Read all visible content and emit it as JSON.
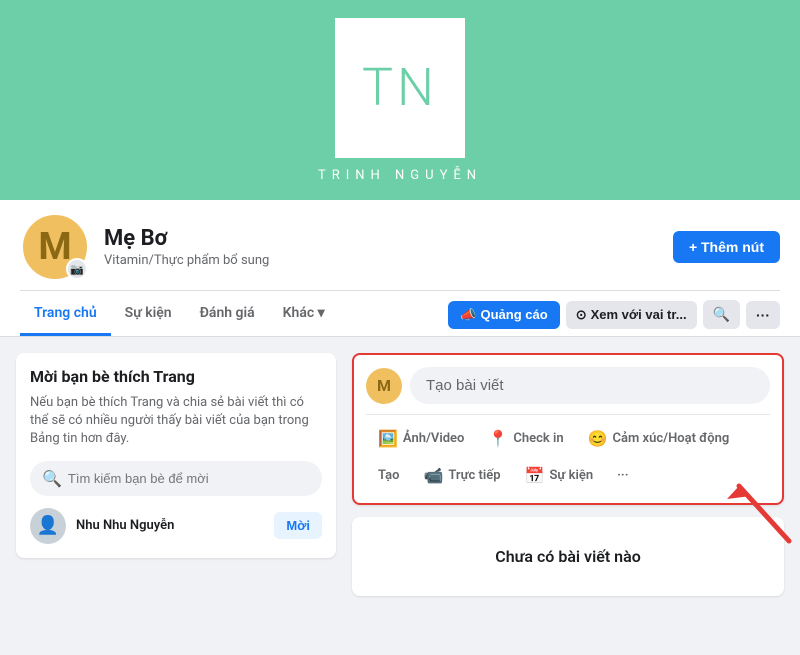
{
  "cover": {
    "logo_letters": "TN",
    "logo_name": "TRINH NGUYỄN",
    "background_color": "#6dcfa8"
  },
  "profile": {
    "avatar_letter": "M",
    "page_name": "Mẹ Bơ",
    "page_category": "Vitamin/Thực phẩm bổ sung",
    "add_button_label": "+ Thêm nút",
    "camera_icon": "📷"
  },
  "nav": {
    "tabs": [
      {
        "label": "Trang chủ",
        "active": true
      },
      {
        "label": "Sự kiện",
        "active": false
      },
      {
        "label": "Đánh giá",
        "active": false
      },
      {
        "label": "Khác ▾",
        "active": false
      }
    ],
    "actions": [
      {
        "label": "📣 Quảng cáo",
        "type": "primary"
      },
      {
        "label": "⊙ Xem với vai tr...",
        "type": "secondary"
      },
      {
        "label": "🔍",
        "type": "icon"
      },
      {
        "label": "···",
        "type": "icon"
      }
    ]
  },
  "left_sidebar": {
    "invite_title": "Mời bạn bè thích Trang",
    "invite_desc": "Nếu bạn bè thích Trang và chia sẻ bài viết thì có thể sẽ có nhiều người thấy bài viết của bạn trong Bảng tin hơn đây.",
    "search_placeholder": "Tìm kiếm bạn bè để mời",
    "friend": {
      "name": "Nhu Nhu Nguyễn",
      "invite_label": "Mời"
    }
  },
  "post_creator": {
    "placeholder": "Tạo bài viết",
    "actions": [
      {
        "icon": "🖼️",
        "label": "Ảnh/Video"
      },
      {
        "icon": "📍",
        "label": "Check in"
      },
      {
        "icon": "😊",
        "label": "Cảm xúc/Hoạt động"
      }
    ],
    "more_actions": [
      {
        "label": "Tạo"
      },
      {
        "icon": "📹",
        "label": "Trực tiếp"
      },
      {
        "icon": "📅",
        "label": "Sự kiện"
      },
      {
        "icon": "···",
        "label": ""
      }
    ]
  },
  "no_posts": {
    "label": "Chưa có bài viết nào"
  },
  "theme": {
    "primary_blue": "#1877f2",
    "highlight_red": "#e53935",
    "bg_gray": "#f0f2f5"
  }
}
